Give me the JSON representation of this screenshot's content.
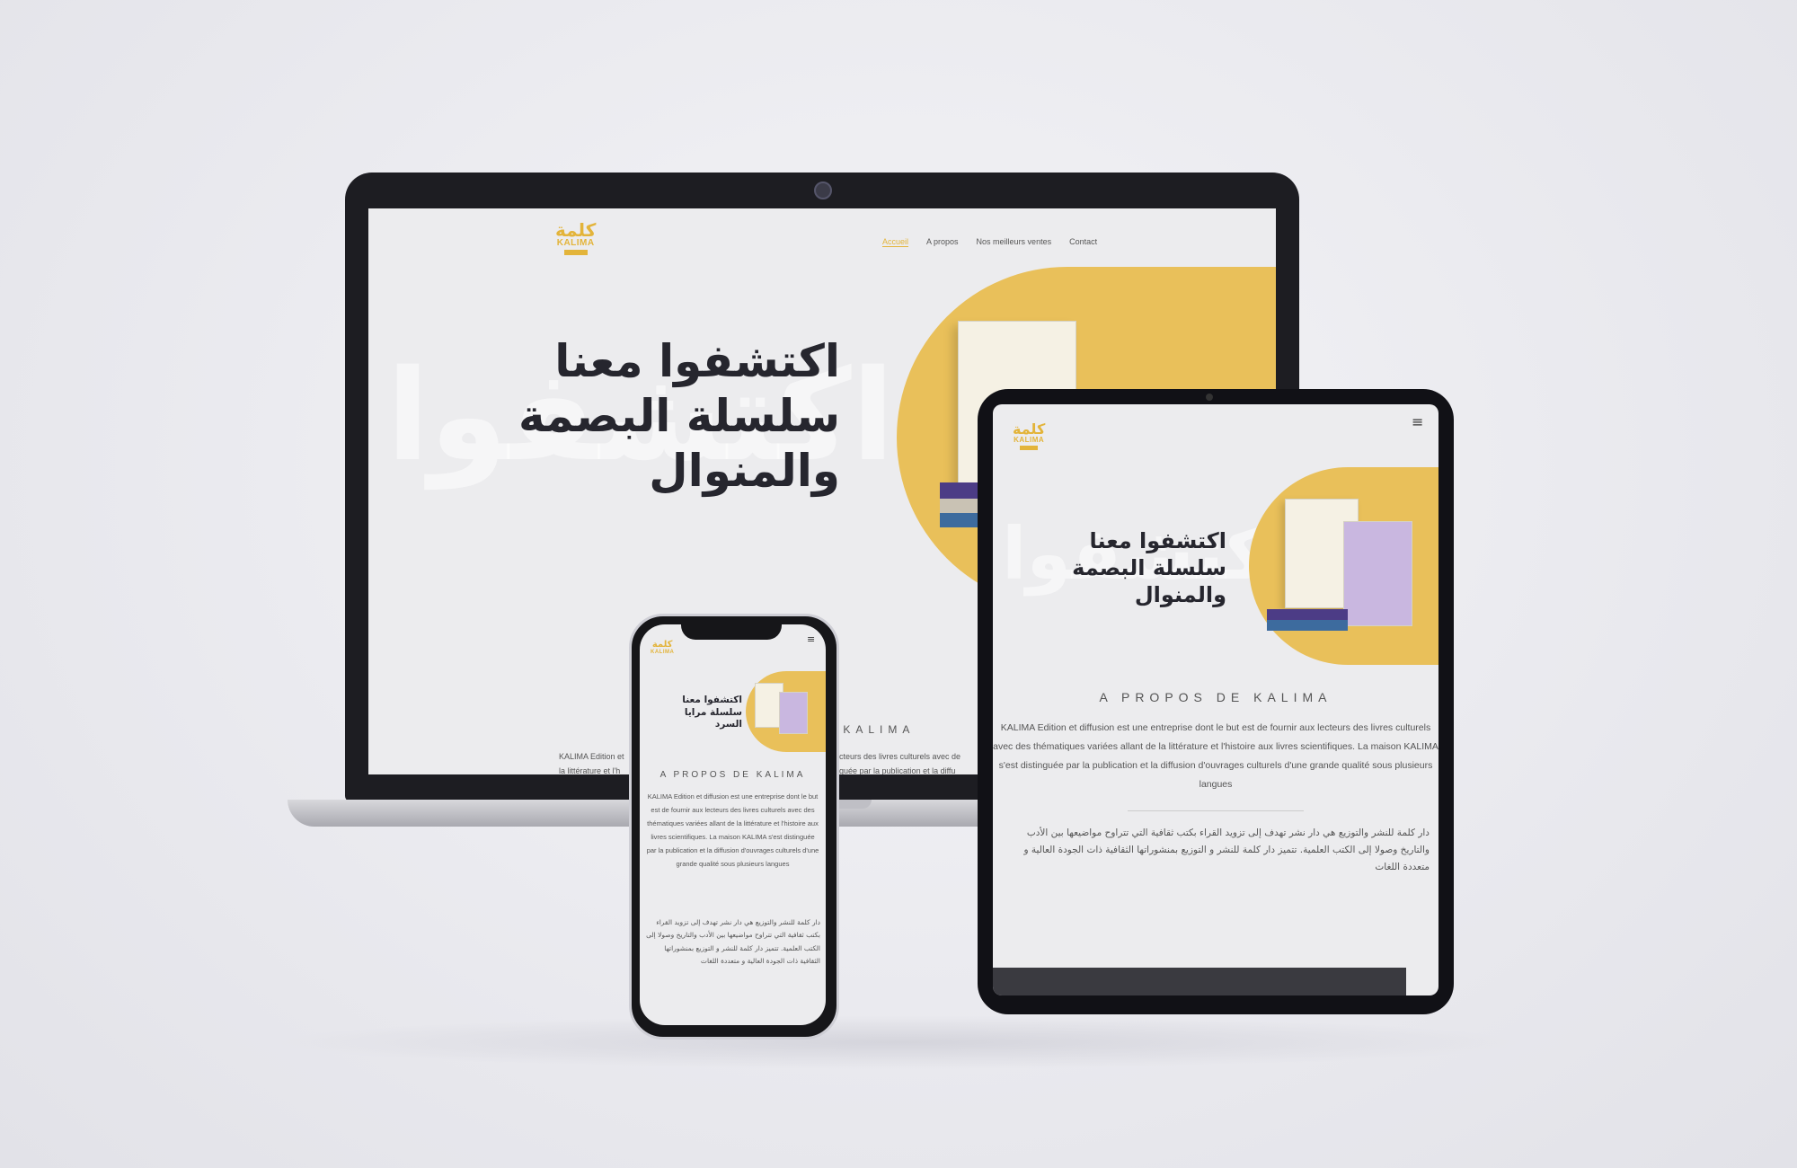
{
  "brand": {
    "logo_ar": "كلمة",
    "logo_latin": "KALIMA",
    "accent": "#e3b43a",
    "blob": "#e9c05a",
    "text_dark": "#26262e"
  },
  "nav": {
    "items": [
      "Accueil",
      "A propos",
      "Nos meilleurs ventes",
      "Contact"
    ],
    "active_index": 0
  },
  "hero": {
    "desktop_lines": [
      "اكتشفوا معنا",
      "سلسلة البصمة",
      "والمنوال"
    ],
    "tablet_lines": [
      "اكتشفوا معنا",
      "سلسلة البصمة",
      "والمنوال"
    ],
    "phone_lines": [
      "اكتشفوا معنا",
      "سلسلة مرايا",
      "السرد"
    ],
    "watermark": "اكتشفوا"
  },
  "about": {
    "title": "A PROPOS DE KALIMA",
    "desktop_title_fragment": "E KALIMA",
    "desktop_fr_fragment_left_1": "KALIMA Edition et",
    "desktop_fr_fragment_right_1": "x lecteurs des livres culturels avec de",
    "desktop_fr_fragment_left_2": "la littérature et l'h",
    "desktop_fr_fragment_right_2": "stinguée par la publication et la diffu",
    "fr_text": "KALIMA Edition et diffusion est une entreprise dont le but est de fournir aux lecteurs des livres culturels avec des thématiques variées allant de la littérature et l'histoire aux livres scientifiques. La maison KALIMA s'est distinguée par la publication et la diffusion d'ouvrages culturels d'une grande qualité sous plusieurs langues",
    "ar_text": "دار كلمة للنشر والتوزيع هي دار نشر تهدف إلى تزويد القراء بكتب ثقافية التي تتراوح مواضيعها بين الأدب والتاريخ وصولا إلى الكتب العلمية. تتميز دار كلمة للنشر و التوزيع بمنشوراتها الثقافية ذات الجودة العالية و متعددة اللغات"
  },
  "icons": {
    "menu": "hamburger-icon",
    "camera": "camera-icon"
  }
}
